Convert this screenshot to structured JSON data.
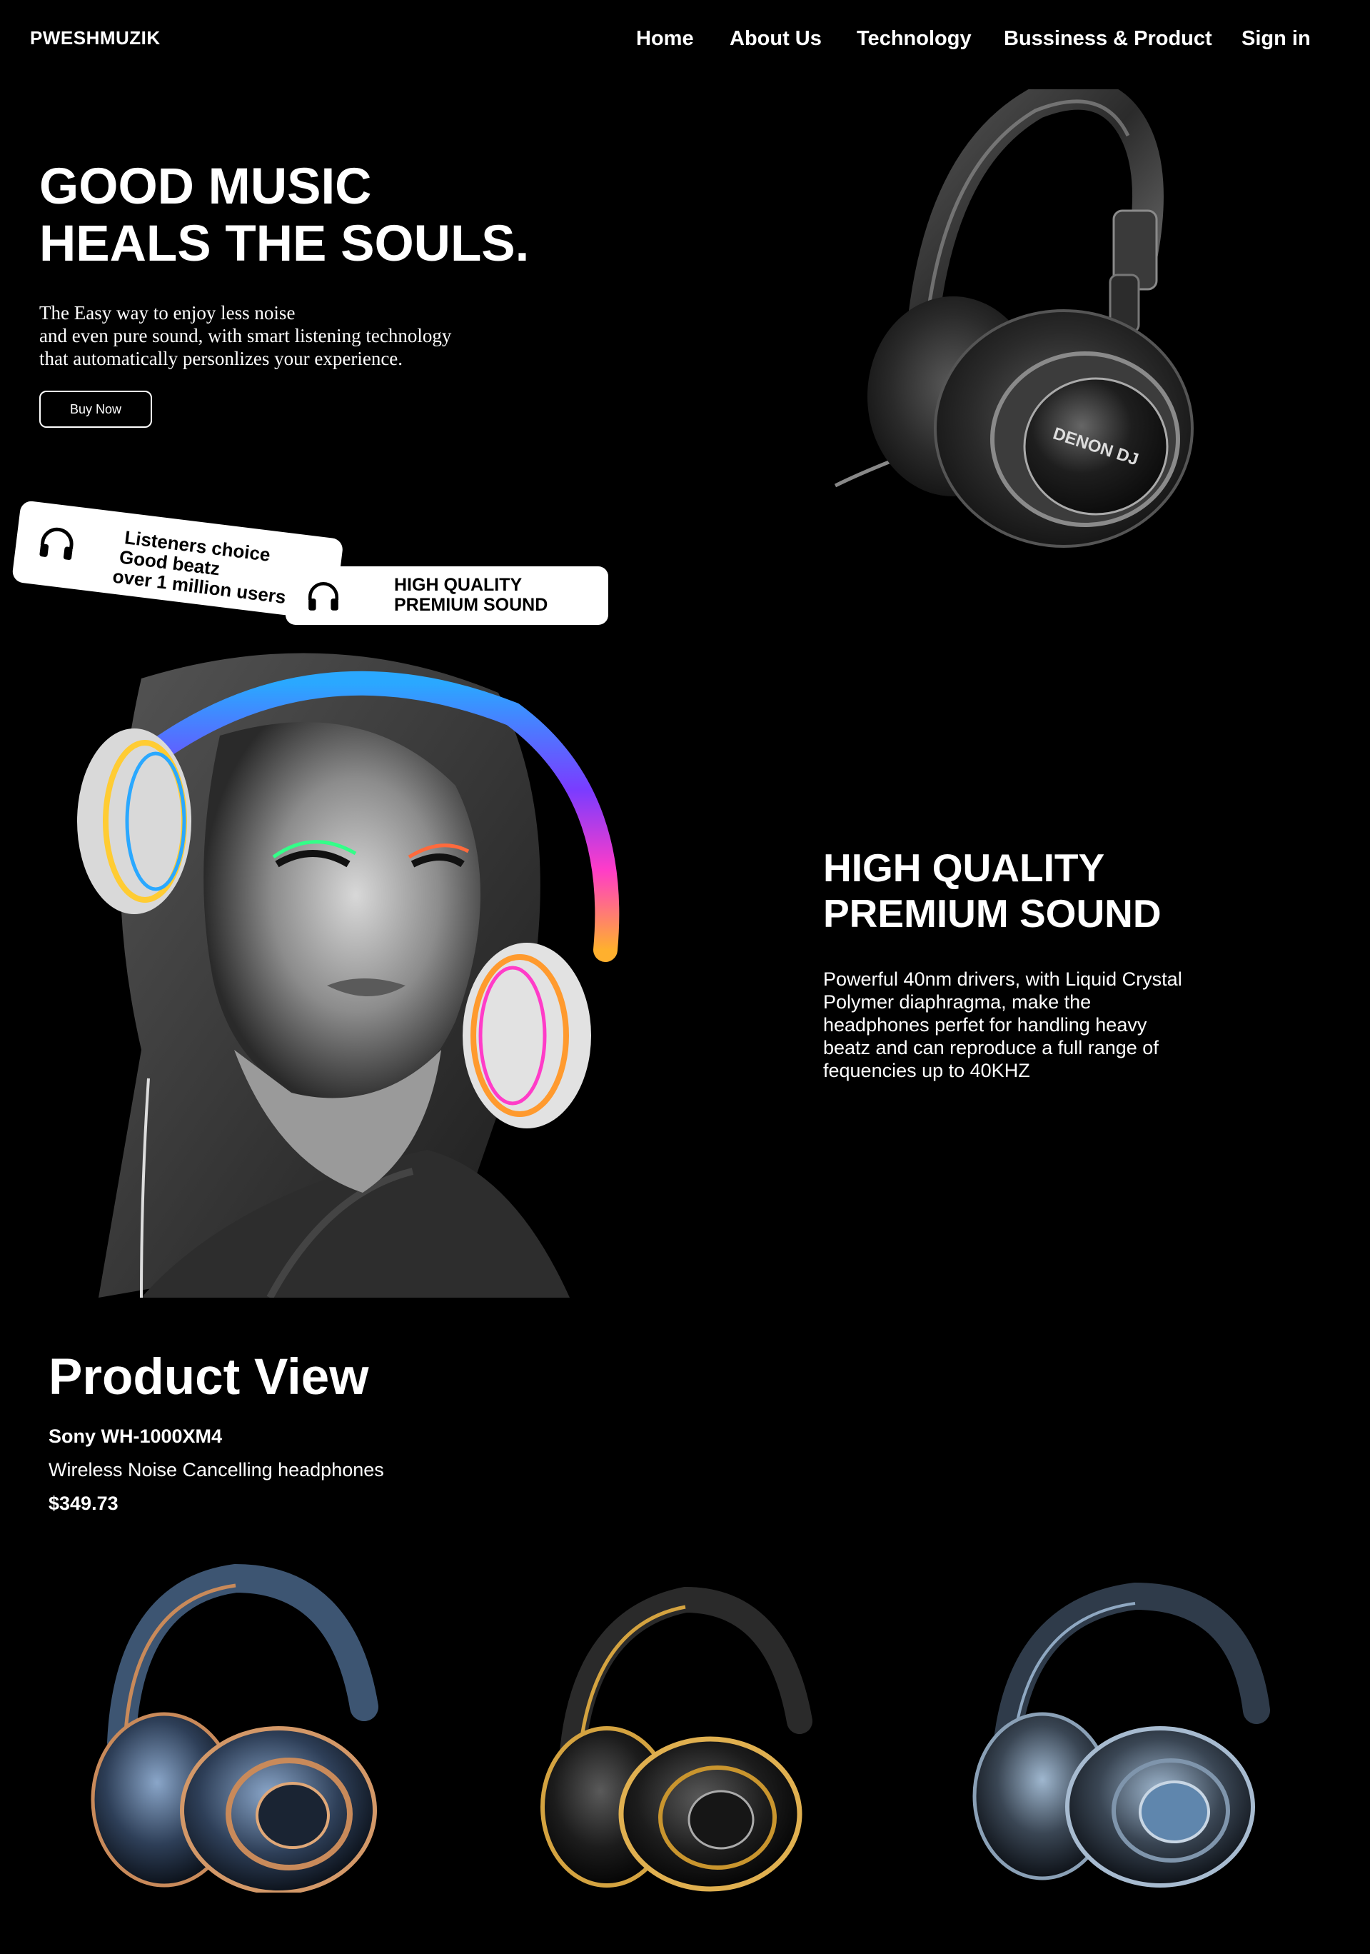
{
  "brand": {
    "logo": "PWESHMUZIK"
  },
  "nav": {
    "items": [
      "Home",
      "About Us",
      "Technology",
      "Bussiness & Product",
      "Sign in"
    ]
  },
  "hero": {
    "title_lines": [
      "GOOD MUSIC",
      "HEALS THE SOULS."
    ],
    "desc_lines": [
      "The Easy way to enjoy less noise",
      "and even pure sound, with smart listening technology",
      "that automatically personlizes your experience."
    ],
    "cta": "Buy Now",
    "headphone_brand_text": "DENON DJ"
  },
  "badges": {
    "listeners": [
      "Listeners choice",
      "Good beatz",
      "over 1 million users"
    ],
    "quality": [
      "HIGH QUALITY",
      "PREMIUM SOUND"
    ]
  },
  "sound": {
    "title_lines": [
      "HIGH QUALITY",
      "PREMIUM SOUND"
    ],
    "description": "Powerful 40nm drivers, with Liquid Crystal Polymer diaphragma, make the headphones perfet for handling heavy beatz and can reproduce a full range of fequencies up to 40KHZ"
  },
  "product": {
    "section_title": "Product View",
    "name": "Sony WH-1000XM4",
    "subtitle": "Wireless Noise Cancelling headphones",
    "price": "$349.73",
    "variants": [
      "copper-blue",
      "black-gold",
      "steel-blue"
    ]
  },
  "colors": {
    "background": "#000000",
    "text": "#ffffff",
    "badge": "#ffffff"
  }
}
